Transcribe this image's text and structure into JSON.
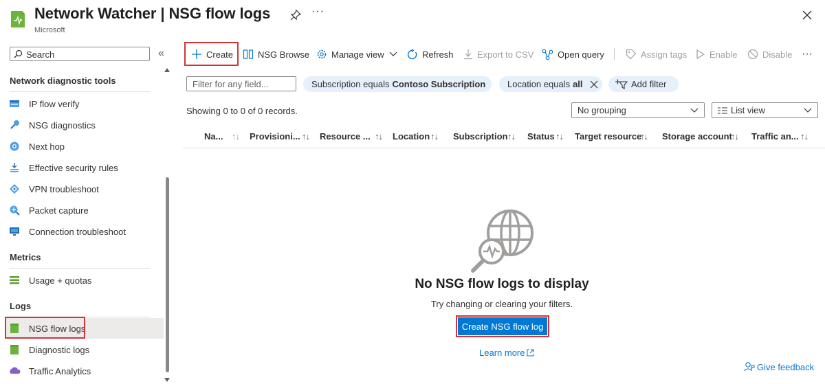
{
  "header": {
    "title": "Network Watcher | NSG flow logs",
    "subtitle": "Microsoft",
    "more": "···"
  },
  "sidebar": {
    "search_placeholder": "Search",
    "collapse": "«",
    "sections": [
      {
        "title": "Network diagnostic tools",
        "items": [
          {
            "label": "IP flow verify",
            "icon": "ip-flow-icon"
          },
          {
            "label": "NSG diagnostics",
            "icon": "nsg-diagnostics-icon"
          },
          {
            "label": "Next hop",
            "icon": "next-hop-icon"
          },
          {
            "label": "Effective security rules",
            "icon": "security-rules-icon"
          },
          {
            "label": "VPN troubleshoot",
            "icon": "vpn-icon"
          },
          {
            "label": "Packet capture",
            "icon": "packet-capture-icon"
          },
          {
            "label": "Connection troubleshoot",
            "icon": "connection-icon"
          }
        ]
      },
      {
        "title": "Metrics",
        "items": [
          {
            "label": "Usage + quotas",
            "icon": "usage-icon"
          }
        ]
      },
      {
        "title": "Logs",
        "items": [
          {
            "label": "NSG flow logs",
            "icon": "nsg-flow-logs-icon",
            "selected": true
          },
          {
            "label": "Diagnostic logs",
            "icon": "diagnostic-logs-icon"
          },
          {
            "label": "Traffic Analytics",
            "icon": "traffic-analytics-icon"
          }
        ]
      }
    ]
  },
  "toolbar": {
    "create": "Create",
    "nsg_browse": "NSG Browse",
    "manage_view": "Manage view",
    "refresh": "Refresh",
    "export_csv": "Export to CSV",
    "open_query": "Open query",
    "assign_tags": "Assign tags",
    "enable": "Enable",
    "disable": "Disable",
    "more": "···"
  },
  "filters": {
    "placeholder": "Filter for any field...",
    "subscription_prefix": "Subscription equals",
    "subscription_value": "Contoso Subscription",
    "location_prefix": "Location equals",
    "location_value": "all",
    "add_filter": "Add filter"
  },
  "records_text": "Showing 0 to 0 of 0 records.",
  "grouping": "No grouping",
  "view_mode": "List view",
  "columns": [
    "Na...",
    "Provisioni...",
    "Resource ...",
    "Location",
    "Subscription",
    "Status",
    "Target resource",
    "Storage account",
    "Traffic an..."
  ],
  "empty_state": {
    "title": "No NSG flow logs to display",
    "subtitle": "Try changing or clearing your filters.",
    "button": "Create NSG flow log",
    "learn_more": "Learn more"
  },
  "feedback": "Give feedback",
  "colors": {
    "accent": "#0078d4",
    "highlight_box": "#d13438",
    "pill_bg": "#e5f0fa",
    "selected_bg": "#edebe9"
  }
}
